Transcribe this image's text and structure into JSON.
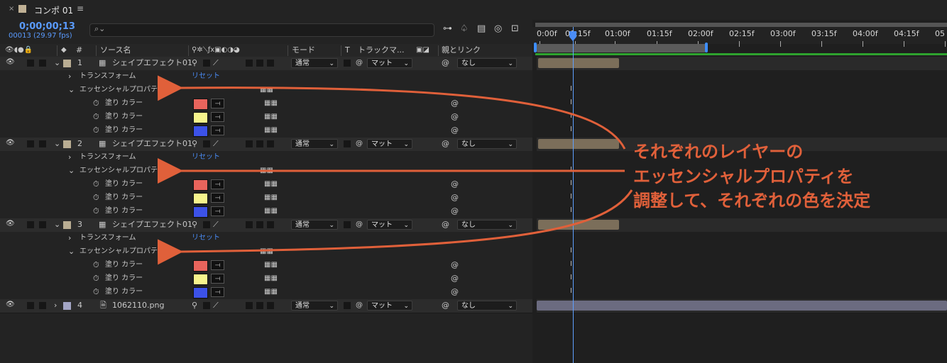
{
  "tab": {
    "close": "×",
    "name": "コンポ 01",
    "menu": "≡"
  },
  "timecode": "0;00;00;13",
  "frame_info": "00013 (29.97 fps)",
  "search": {
    "placeholder": "",
    "icon": "search-icon"
  },
  "columns": {
    "index": "#",
    "source_name": "ソース名",
    "mode": "モード",
    "t": "T",
    "track_matte": "トラックマ...",
    "parent_link": "親とリンク"
  },
  "layers": [
    {
      "num": "1",
      "name": "シェイプエフェクト01",
      "mode": "通常",
      "matte": "マット",
      "parent": "なし",
      "label_color": "#b9ad93",
      "transform": "トランスフォーム",
      "reset": "リセット",
      "essential": "エッセンシャルプロパティ",
      "props": [
        {
          "label": "塗り カラー",
          "color": "#e8645c"
        },
        {
          "label": "塗り カラー",
          "color": "#f6f48c"
        },
        {
          "label": "塗り カラー",
          "color": "#3c52e8"
        }
      ]
    },
    {
      "num": "2",
      "name": "シェイプエフェクト01",
      "mode": "通常",
      "matte": "マット",
      "parent": "なし",
      "label_color": "#b9ad93",
      "transform": "トランスフォーム",
      "reset": "リセット",
      "essential": "エッセンシャルプロパティ",
      "props": [
        {
          "label": "塗り カラー",
          "color": "#e8645c"
        },
        {
          "label": "塗り カラー",
          "color": "#f6f48c"
        },
        {
          "label": "塗り カラー",
          "color": "#3c52e8"
        }
      ]
    },
    {
      "num": "3",
      "name": "シェイプエフェクト01",
      "mode": "通常",
      "matte": "マット",
      "parent": "なし",
      "label_color": "#b9ad93",
      "transform": "トランスフォーム",
      "reset": "リセット",
      "essential": "エッセンシャルプロパティ",
      "props": [
        {
          "label": "塗り カラー",
          "color": "#e8645c"
        },
        {
          "label": "塗り カラー",
          "color": "#f6f48c"
        },
        {
          "label": "塗り カラー",
          "color": "#3c52e8"
        }
      ]
    }
  ],
  "layer4": {
    "num": "4",
    "name": "1062110.png",
    "mode": "通常",
    "matte": "マット",
    "parent": "なし",
    "label_color": "#a4a6c6"
  },
  "ruler_labels": [
    "0:00f",
    "00:15f",
    "01:00f",
    "01:15f",
    "02:00f",
    "02:15f",
    "03:00f",
    "03:15f",
    "04:00f",
    "04:15f",
    "05"
  ],
  "annotation": {
    "line1": "それぞれのレイヤーの",
    "line2": "エッセンシャルプロパティを",
    "line3": "調整して、それぞれの色を決定",
    "color": "#e0603a"
  }
}
